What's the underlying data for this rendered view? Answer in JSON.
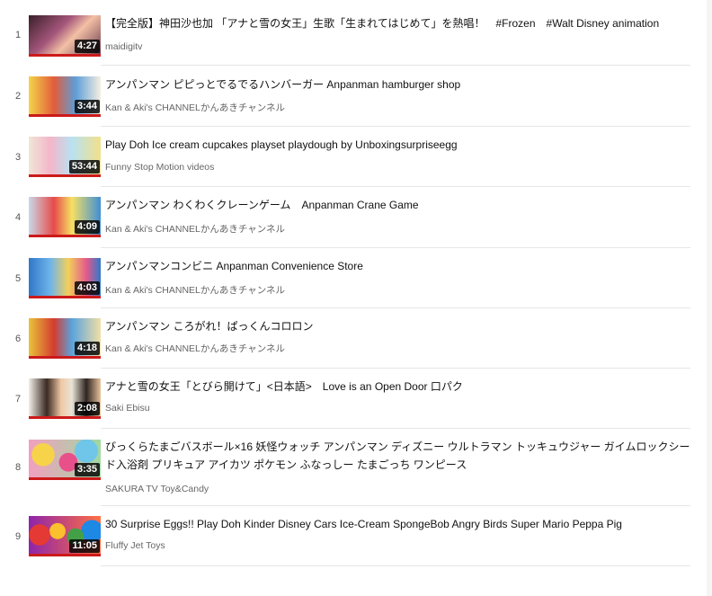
{
  "playlist": {
    "items": [
      {
        "index": "1",
        "title": "【完全版】神田沙也加 「アナと雪の女王」生歌「生まれてはじめて」を熱唱！　#Frozen　#Walt Disney animation",
        "channel": "maidigitv",
        "duration": "4:27"
      },
      {
        "index": "2",
        "title": "アンパンマン ピピっとでるでるハンバーガー Anpanman hamburger shop",
        "channel": "Kan & Aki's CHANNELかんあきチャンネル",
        "duration": "3:44"
      },
      {
        "index": "3",
        "title": "Play Doh Ice cream cupcakes playset playdough by Unboxingsurpriseegg",
        "channel": "Funny Stop Motion videos",
        "duration": "53:44"
      },
      {
        "index": "4",
        "title": "アンパンマン わくわくクレーンゲーム　Anpanman Crane Game",
        "channel": "Kan & Aki's CHANNELかんあきチャンネル",
        "duration": "4:09"
      },
      {
        "index": "5",
        "title": "アンパンマンコンビニ Anpanman Convenience Store",
        "channel": "Kan & Aki's CHANNELかんあきチャンネル",
        "duration": "4:03"
      },
      {
        "index": "6",
        "title": "アンパンマン ころがれ！ぱっくんコロロン",
        "channel": "Kan & Aki's CHANNELかんあきチャンネル",
        "duration": "4:18"
      },
      {
        "index": "7",
        "title": "アナと雪の女王「とびら開けて」<日本語>　Love is an Open Door 口パク",
        "channel": "Saki Ebisu",
        "duration": "2:08"
      },
      {
        "index": "8",
        "title": "びっくらたまごバスボール×16 妖怪ウォッチ アンパンマン ディズニー ウルトラマン トッキュウジャー ガイムロックシード入浴剤 プリキュア アイカツ ポケモン ふなっしー たまごっち ワンピース",
        "channel": "SAKURA TV Toy&Candy",
        "duration": "3:35"
      },
      {
        "index": "9",
        "title": "30 Surprise Eggs!! Play Doh Kinder Disney Cars Ice-Cream SpongeBob Angry Birds Super Mario Peppa Pig",
        "channel": "Fluffy Jet Toys",
        "duration": "11:05"
      }
    ]
  },
  "colors": {
    "progress_bar": "#cc1a1a",
    "duration_bg": "#000000",
    "divider": "#e6e6e6"
  }
}
